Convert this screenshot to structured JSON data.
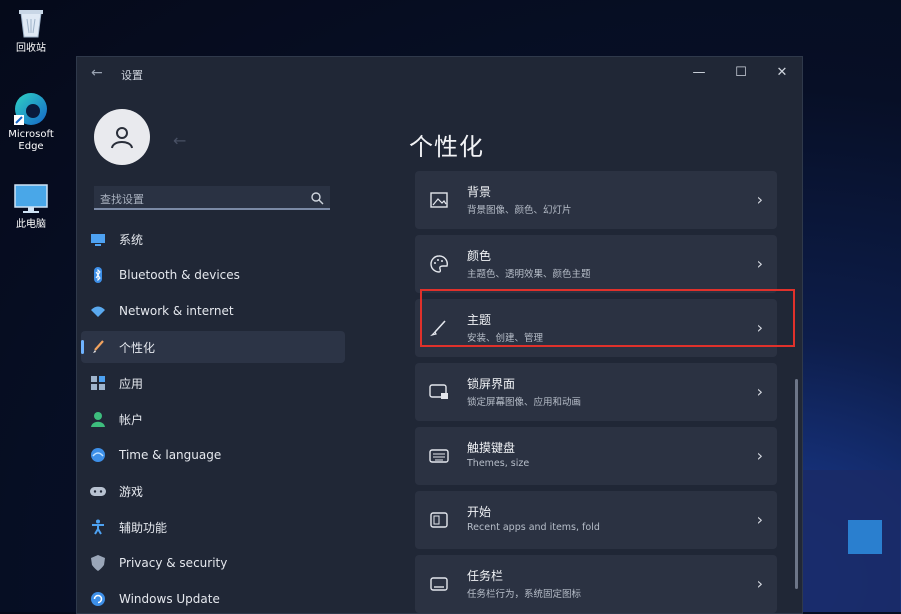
{
  "desktop": {
    "icons": [
      {
        "label": "回收站",
        "icon": "recycle-bin-icon"
      },
      {
        "label": "Microsoft Edge",
        "icon": "edge-icon"
      },
      {
        "label": "此电脑",
        "icon": "monitor-icon"
      }
    ]
  },
  "window": {
    "title": "设置",
    "controls": {
      "minimize": "—",
      "maximize": "☐",
      "close": "✕"
    }
  },
  "search": {
    "placeholder": "查找设置"
  },
  "nav": [
    {
      "label": "系统",
      "icon": "system-icon"
    },
    {
      "label": "Bluetooth & devices",
      "icon": "bluetooth-icon"
    },
    {
      "label": "Network & internet",
      "icon": "wifi-icon"
    },
    {
      "label": "个性化",
      "icon": "brush-icon",
      "active": true
    },
    {
      "label": "应用",
      "icon": "apps-icon"
    },
    {
      "label": "帐户",
      "icon": "account-icon"
    },
    {
      "label": "Time & language",
      "icon": "globe-icon"
    },
    {
      "label": "游戏",
      "icon": "gamepad-icon"
    },
    {
      "label": "辅助功能",
      "icon": "accessibility-icon"
    },
    {
      "label": "Privacy & security",
      "icon": "shield-icon"
    },
    {
      "label": "Windows Update",
      "icon": "update-icon"
    }
  ],
  "main": {
    "title": "个性化",
    "cards": [
      {
        "title": "背景",
        "subtitle": "背景图像、颜色、幻灯片",
        "icon": "image-icon"
      },
      {
        "title": "颜色",
        "subtitle": "主题色、透明效果、颜色主题",
        "icon": "palette-icon"
      },
      {
        "title": "主题",
        "subtitle": "安装、创建、管理",
        "icon": "brush-icon",
        "highlighted": true
      },
      {
        "title": "锁屏界面",
        "subtitle": "锁定屏幕图像、应用和动画",
        "icon": "lockscreen-icon"
      },
      {
        "title": "触摸键盘",
        "subtitle": "Themes, size",
        "icon": "keyboard-icon"
      },
      {
        "title": "开始",
        "subtitle": "Recent apps and items, fold",
        "icon": "start-icon"
      },
      {
        "title": "任务栏",
        "subtitle": "任务栏行为，系统固定图标",
        "icon": "taskbar-icon"
      }
    ],
    "chevron": "›"
  },
  "colors": {
    "accent": "#6fb3ff",
    "highlight_border": "#e0312b",
    "window_bg": "#202736",
    "card_bg": "#2b3242"
  }
}
